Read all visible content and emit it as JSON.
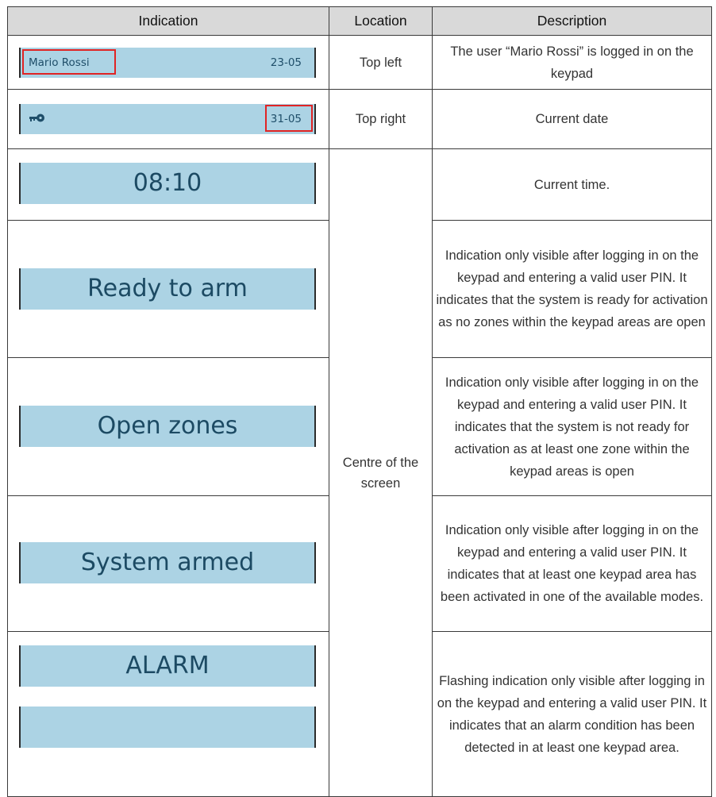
{
  "table": {
    "headers": {
      "indication": "Indication",
      "location": "Location",
      "description": "Description"
    },
    "rows": [
      {
        "lcd": {
          "left_text": "Mario Rossi",
          "right_text": "23-05",
          "highlight": "left"
        },
        "location": "Top left",
        "description": "The user “Mario Rossi” is logged in on the keypad"
      },
      {
        "lcd": {
          "icon": "key-icon",
          "right_text": "31-05",
          "highlight": "right"
        },
        "location": "Top right",
        "description": "Current date"
      },
      {
        "lcd": {
          "big_text": "08:10"
        },
        "description": "Current time."
      },
      {
        "lcd": {
          "big_text": "Ready to arm"
        },
        "description": "Indication only visible after logging in on the keypad and entering a valid user PIN. It indicates that the system is ready for activation as no zones within the keypad areas are open"
      },
      {
        "lcd": {
          "big_text": "Open zones"
        },
        "description": "Indication only visible after logging in on the keypad and entering a valid user PIN. It indicates that the system is not ready for activation as at least one zone within the keypad areas is open"
      },
      {
        "lcd": {
          "big_text": "System armed"
        },
        "description": "Indication only visible after logging in on the keypad and entering a valid user PIN. It indicates that at least one keypad area has been activated in one of the available modes."
      },
      {
        "lcd": {
          "big_text": "ALARM",
          "second_display_text": ""
        },
        "description": "Flashing indication only visible after logging in on the keypad and entering a valid user PIN. It indicates that an alarm condition has been detected in at least one keypad area."
      }
    ],
    "merged_location": "Centre of the screen"
  },
  "colors": {
    "lcd_background": "#acd3e4",
    "lcd_text": "#1f4e69",
    "highlight_box": "#e02424",
    "header_background": "#d9d9d9"
  }
}
